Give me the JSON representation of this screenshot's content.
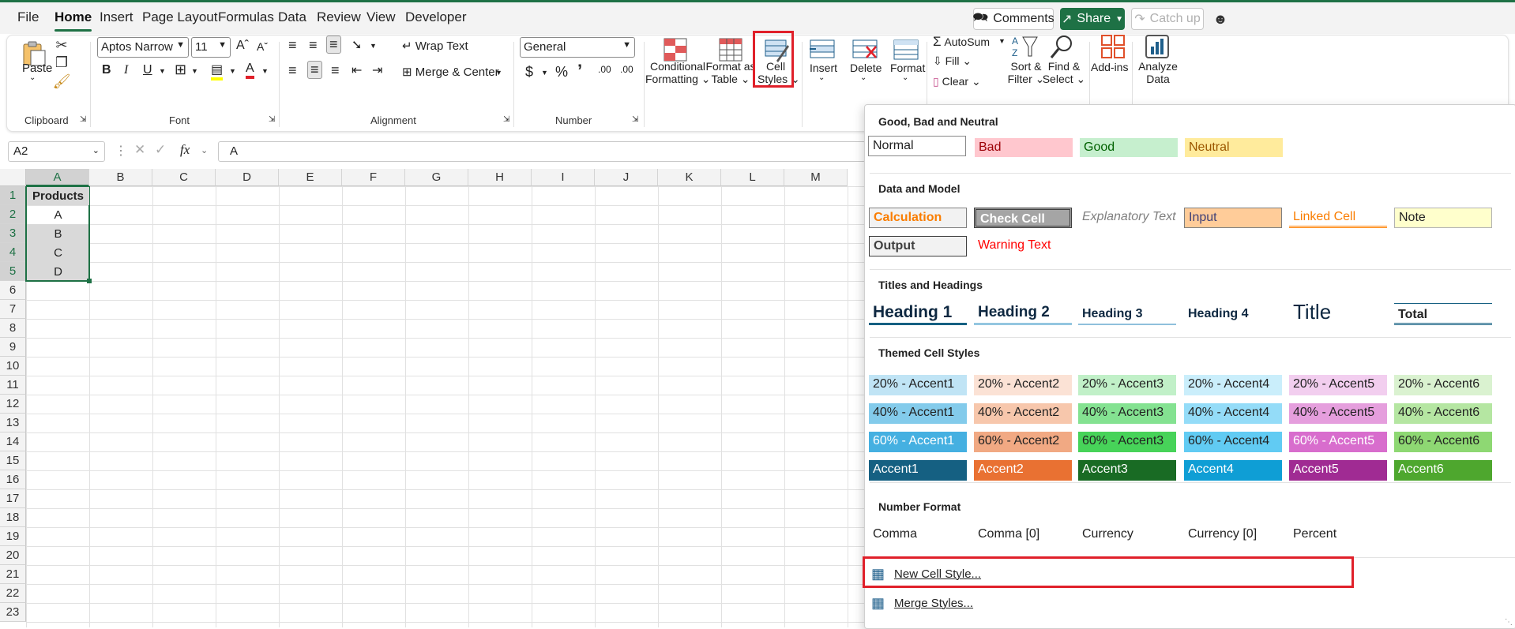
{
  "menu": {
    "tabs": [
      "File",
      "Home",
      "Insert",
      "Page Layout",
      "Formulas",
      "Data",
      "Review",
      "View",
      "Developer"
    ],
    "comments_label": "Comments",
    "share_label": "Share",
    "catchup_label": "Catch up"
  },
  "ribbon": {
    "clipboard": {
      "paste_label": "Paste",
      "group_label": "Clipboard"
    },
    "font": {
      "font_name": "Aptos Narrow",
      "font_size": "11",
      "group_label": "Font"
    },
    "alignment": {
      "wrap_text_label": "Wrap Text",
      "merge_center_label": "Merge & Center",
      "group_label": "Alignment"
    },
    "number": {
      "format_value": "General",
      "group_label": "Number"
    },
    "styles": {
      "conditional_formatting_line1": "Conditional",
      "conditional_formatting_line2": "Formatting",
      "format_table_line1": "Format as",
      "format_table_line2": "Table",
      "cell_styles_line1": "Cell",
      "cell_styles_line2": "Styles"
    },
    "cells": {
      "insert_label": "Insert",
      "delete_label": "Delete",
      "format_label": "Format"
    },
    "editing": {
      "autosum_label": "AutoSum",
      "fill_label": "Fill",
      "clear_label": "Clear",
      "sort_line1": "Sort &",
      "sort_line2": "Filter",
      "find_line1": "Find &",
      "find_line2": "Select"
    },
    "addins_label": "Add-ins",
    "analyze_line1": "Analyze",
    "analyze_line2": "Data"
  },
  "formula_bar": {
    "name_box": "A2",
    "fx_label": "fx",
    "value": "A"
  },
  "grid": {
    "columns": [
      "A",
      "B",
      "C",
      "D",
      "E",
      "F",
      "G",
      "H",
      "I",
      "J",
      "K",
      "L",
      "M"
    ],
    "rows": [
      "1",
      "2",
      "3",
      "4",
      "5",
      "6",
      "7",
      "8",
      "9",
      "10",
      "11",
      "12",
      "13",
      "14",
      "15",
      "16",
      "17",
      "18",
      "19",
      "20",
      "21",
      "22",
      "23"
    ],
    "cells": {
      "A1": "Products",
      "A2": "A",
      "A3": "B",
      "A4": "C",
      "A5": "D"
    }
  },
  "cell_styles_menu": {
    "good_bad_header": "Good, Bad and Neutral",
    "good_bad": [
      "Normal",
      "Bad",
      "Good",
      "Neutral"
    ],
    "data_model_header": "Data and Model",
    "data_model_row1": [
      "Calculation",
      "Check Cell",
      "Explanatory Text",
      "Input",
      "Linked Cell",
      "Note"
    ],
    "data_model_row2": [
      "Output",
      "Warning Text"
    ],
    "titles_header": "Titles and Headings",
    "titles": [
      "Heading 1",
      "Heading 2",
      "Heading 3",
      "Heading 4",
      "Title",
      "Total"
    ],
    "themed_header": "Themed Cell Styles",
    "themed_rows": [
      [
        "20% - Accent1",
        "20% - Accent2",
        "20% - Accent3",
        "20% - Accent4",
        "20% - Accent5",
        "20% - Accent6"
      ],
      [
        "40% - Accent1",
        "40% - Accent2",
        "40% - Accent3",
        "40% - Accent4",
        "40% - Accent5",
        "40% - Accent6"
      ],
      [
        "60% - Accent1",
        "60% - Accent2",
        "60% - Accent3",
        "60% - Accent4",
        "60% - Accent5",
        "60% - Accent6"
      ],
      [
        "Accent1",
        "Accent2",
        "Accent3",
        "Accent4",
        "Accent5",
        "Accent6"
      ]
    ],
    "number_format_header": "Number Format",
    "number_formats": [
      "Comma",
      "Comma [0]",
      "Currency",
      "Currency [0]",
      "Percent"
    ],
    "new_cell_style_label": "New Cell Style...",
    "merge_styles_label": "Merge Styles..."
  },
  "colors": {
    "brand_green": "#1e7145",
    "highlight_red": "#e0202a",
    "accent1": "#156082",
    "accent2": "#e97132",
    "accent3": "#196b24",
    "accent4": "#0f9ed5",
    "accent5": "#a02b93",
    "accent6": "#4ea72e"
  }
}
